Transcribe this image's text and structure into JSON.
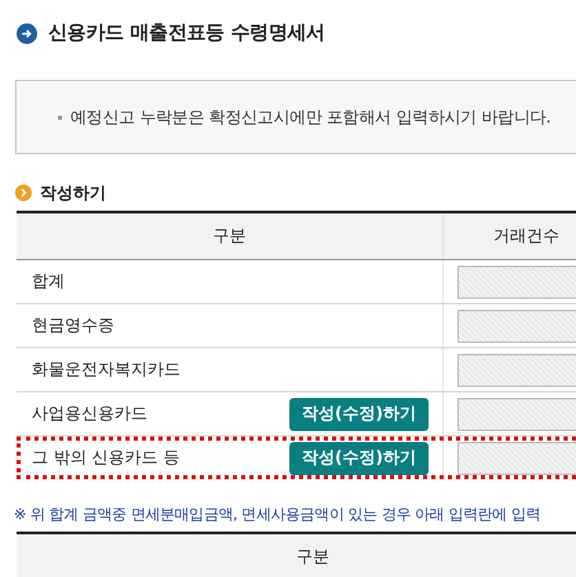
{
  "title": "신용카드 매출전표등 수령명세서",
  "notice": "예정신고 누락분은 확정신고시에만 포함해서 입력하시기 바랍니다.",
  "section_title": "작성하기",
  "table": {
    "columns": [
      "구분",
      "거래건수"
    ],
    "rows": [
      {
        "label": "합계",
        "kind": "plain",
        "highlighted": false,
        "count_disabled": true
      },
      {
        "label": "현금영수증",
        "kind": "plain",
        "highlighted": false,
        "count_disabled": true
      },
      {
        "label": "화물운전자복지카드",
        "kind": "plain",
        "highlighted": false,
        "count_disabled": true
      },
      {
        "label": "사업용신용카드",
        "kind": "button",
        "button": "작성(수정)하기",
        "highlighted": false,
        "count_disabled": true
      },
      {
        "label": "그 밖의 신용카드 등",
        "kind": "button",
        "button": "작성(수정)하기",
        "highlighted": true,
        "count_disabled": true
      }
    ]
  },
  "note": "※ 위 합계 금액중 면세분매입금액, 면세사용금액이 있는 경우 아래 입력란에 입력",
  "table2": {
    "columns": [
      "구분"
    ]
  }
}
